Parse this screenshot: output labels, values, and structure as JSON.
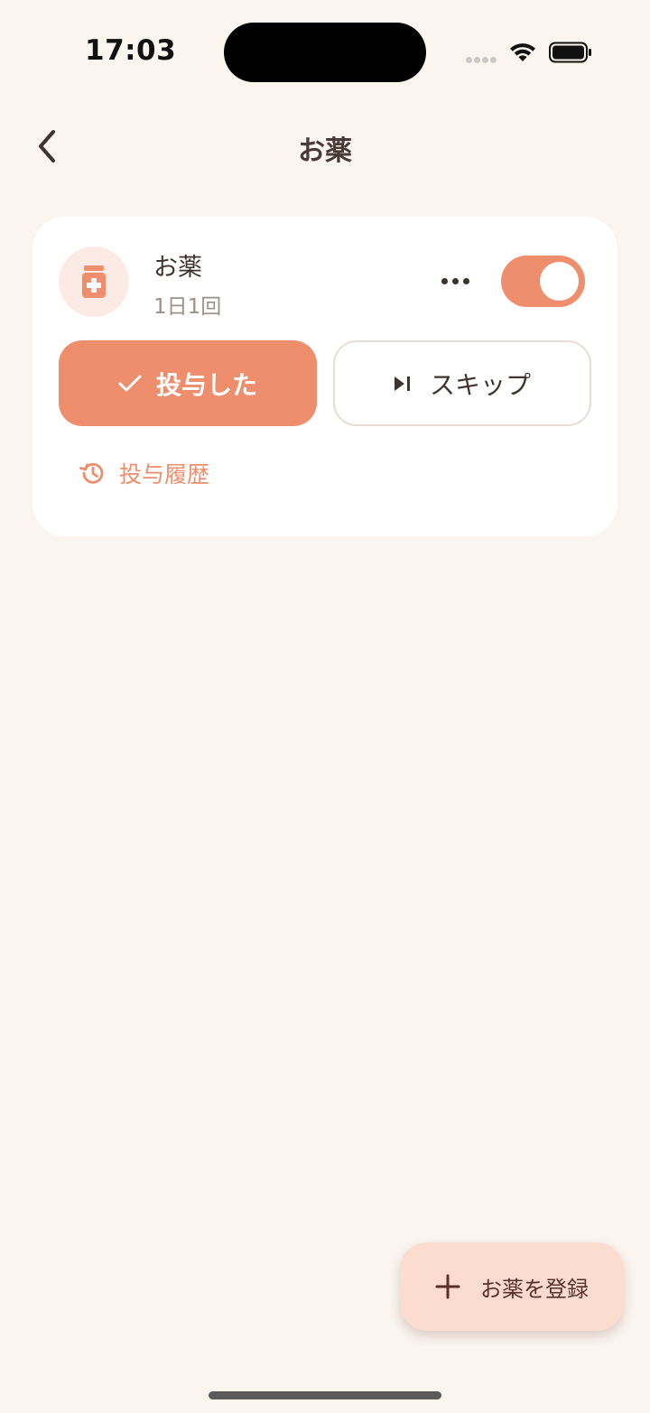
{
  "status_bar": {
    "time": "17:03"
  },
  "header": {
    "title": "お薬",
    "back_icon": "chevron-left-icon"
  },
  "medication": {
    "name": "お薬",
    "frequency": "1日1回",
    "icon": "medicine-bottle-icon",
    "enabled": true,
    "done_label": "投与した",
    "skip_label": "スキップ",
    "history_label": "投与履歴"
  },
  "fab": {
    "label": "お薬を登録"
  },
  "colors": {
    "background": "#FAF5EF",
    "accent": "#EE8E6C",
    "accent_light": "#FCEBE4",
    "fab_background": "#FDDCD0",
    "text_primary": "#3F3330",
    "text_secondary": "#9B918C"
  }
}
